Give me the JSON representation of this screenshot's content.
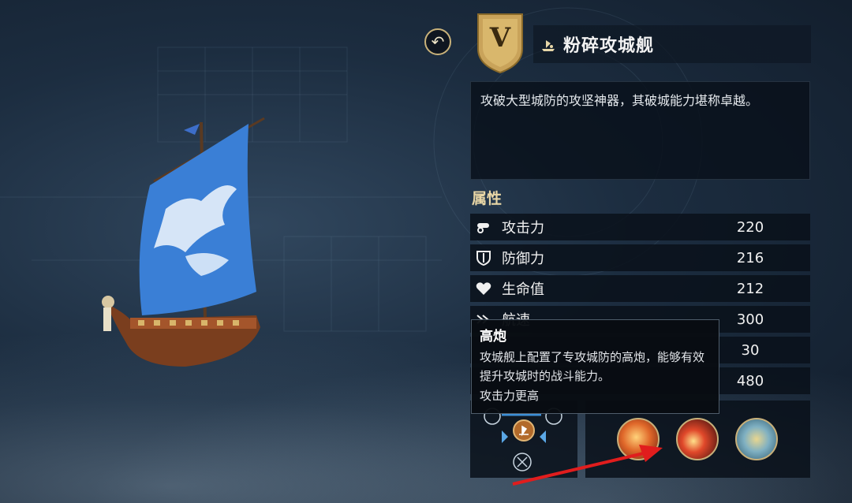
{
  "header": {
    "rank_letter": "V",
    "ship_name": "粉碎攻城舰",
    "back_icon": "back-arrow-icon"
  },
  "description": "攻破大型城防的攻坚神器，其破城能力堪称卓越。",
  "attributes_title": "属性",
  "attributes": [
    {
      "icon": "cannon-icon",
      "label": "攻击力",
      "value": "220"
    },
    {
      "icon": "shield-icon",
      "label": "防御力",
      "value": "216"
    },
    {
      "icon": "heart-icon",
      "label": "生命值",
      "value": "212"
    },
    {
      "icon": "speed-icon",
      "label": "航速",
      "value": "300"
    },
    {
      "icon": "stat5-icon",
      "label": "",
      "value": "30"
    },
    {
      "icon": "stat6-icon",
      "label": "",
      "value": "480"
    }
  ],
  "tooltip": {
    "title": "高炮",
    "body": "攻城舰上配置了专攻城防的高炮，能够有效提升攻城时的战斗能力。",
    "footer": "攻击力更高"
  },
  "skills": [
    "fire-orb-icon",
    "cannon-orb-icon",
    "scale-orb-icon"
  ],
  "colors": {
    "accent_gold": "#c9b27a",
    "arrow_red": "#e11d1d",
    "panel_bg": "#09101a"
  }
}
